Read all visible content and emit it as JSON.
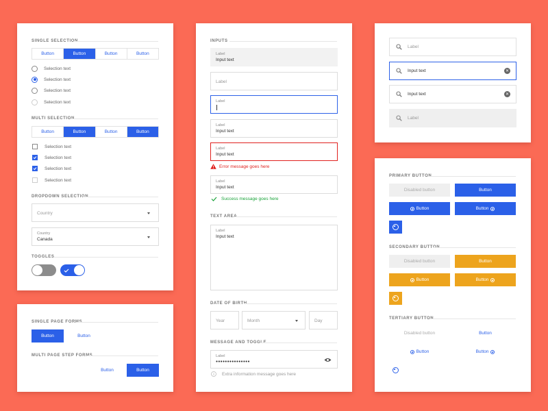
{
  "selection_card": {
    "single_title": "SINGLE SELECTION",
    "single_buttons": [
      {
        "label": "Button",
        "active": false
      },
      {
        "label": "Button",
        "active": true
      },
      {
        "label": "Button",
        "active": false
      },
      {
        "label": "Button",
        "active": false
      }
    ],
    "radios": [
      {
        "label": "Selection text",
        "state": "off"
      },
      {
        "label": "Selection text",
        "state": "on"
      },
      {
        "label": "Selection text",
        "state": "off"
      },
      {
        "label": "Selection text",
        "state": "disabled"
      }
    ],
    "multi_title": "MULTI SELECTION",
    "multi_buttons": [
      {
        "label": "Button",
        "active": false
      },
      {
        "label": "Button",
        "active": true
      },
      {
        "label": "Button",
        "active": false
      },
      {
        "label": "Button",
        "active": true
      }
    ],
    "checkboxes": [
      {
        "label": "Selection text",
        "state": "off"
      },
      {
        "label": "Selection text",
        "state": "on"
      },
      {
        "label": "Selection text",
        "state": "on"
      },
      {
        "label": "Selection text",
        "state": "disabled"
      }
    ],
    "dropdown_title": "DROPDOWN SELECTION",
    "dropdown_empty_placeholder": "Country",
    "dropdown_filled_label": "Country",
    "dropdown_filled_value": "Canada",
    "toggles_title": "TOGGLES",
    "toggles": [
      {
        "on": false
      },
      {
        "on": true
      }
    ]
  },
  "forms_card": {
    "single_title": "SINGLE PAGE FORMS",
    "single_primary": "Button",
    "single_secondary": "Button",
    "multi_title": "MULTI PAGE STEP FORMS",
    "multi_secondary": "Button",
    "multi_primary": "Button"
  },
  "inputs_card": {
    "inputs_title": "INPUTS",
    "filled_label": "Label",
    "filled_value": "Input text",
    "empty_placeholder": "Label",
    "focused_label": "Label",
    "normal_label": "Label",
    "normal_value": "Input text",
    "error_label": "Label",
    "error_value": "Input text",
    "error_message": "Error message goes here",
    "success_label": "Label",
    "success_value": "Input text",
    "success_message": "Success message goes here",
    "textarea_title": "TEXT AREA",
    "textarea_label": "Label",
    "textarea_value": "Input text",
    "dob_title": "DATE OF BIRTH",
    "dob_year": "Year",
    "dob_month": "Month",
    "dob_day": "Day",
    "message_title": "MESSAGE AND TOGGLE",
    "password_label": "Label",
    "password_value": "●●●●●●●●●●●●●●●",
    "info_message": "Extra information message goes here"
  },
  "search_card": {
    "fields": [
      {
        "text": "Label",
        "state": "placeholder",
        "clear": false
      },
      {
        "text": "Input text",
        "state": "focused",
        "clear": true
      },
      {
        "text": "Input text",
        "state": "filled",
        "clear": true
      },
      {
        "text": "Label",
        "state": "disabled",
        "clear": false
      }
    ]
  },
  "buttons_card": {
    "primary_title": "PRIMARY BUTTON",
    "primary_disabled": "Disabled button",
    "primary_button": "Button",
    "primary_icon_left": "Button",
    "primary_icon_right": "Button",
    "secondary_title": "SECONDARY BUTTON",
    "secondary_disabled": "Disabled button",
    "secondary_button": "Button",
    "secondary_icon_left": "Button",
    "secondary_icon_right": "Button",
    "tertiary_title": "TERTIARY BUTTON",
    "tertiary_disabled": "Disabled button",
    "tertiary_button": "Button",
    "tertiary_icon_left": "Button",
    "tertiary_icon_right": "Button"
  },
  "colors": {
    "background": "#fb6a55",
    "primary": "#2b60e8",
    "secondary": "#eda41d",
    "error": "#e0201d",
    "success": "#1aa33a"
  }
}
